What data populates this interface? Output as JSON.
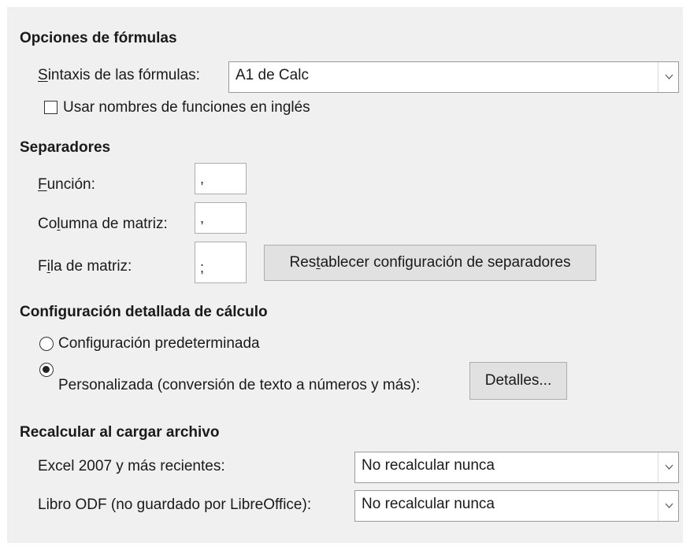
{
  "formula_options": {
    "heading": "Opciones de fórmulas",
    "syntax": {
      "label_prefix": "",
      "label_mnemonic": "S",
      "label_rest": "intaxis de las fórmulas:",
      "value": "A1 de Calc"
    },
    "english_names": {
      "label": "Usar nombres de funciones en inglés",
      "checked": false
    }
  },
  "separators": {
    "heading": "Separadores",
    "function": {
      "label_prefix": "",
      "label_mnemonic": "F",
      "label_rest": "unción:",
      "value": ","
    },
    "array_column": {
      "label_prefix": "Co",
      "label_mnemonic": "l",
      "label_rest": "umna de matriz:",
      "value": ","
    },
    "array_row": {
      "label_prefix": "F",
      "label_mnemonic": "i",
      "label_rest": "la de matriz:",
      "value": ";"
    },
    "reset_button": {
      "label_prefix": "Res",
      "label_mnemonic": "t",
      "label_rest": "ablecer configuración de separadores"
    }
  },
  "detailed_calc": {
    "heading": "Configuración detallada de cálculo",
    "default_option": {
      "label": "Configuración predeterminada",
      "selected": false
    },
    "custom_option": {
      "label": "Personalizada (conversión de texto a números y más):",
      "selected": true
    },
    "details_button": "Detalles..."
  },
  "recalc_on_load": {
    "heading": "Recalcular al cargar archivo",
    "excel": {
      "label": "Excel 2007 y más recientes:",
      "value": "No recalcular nunca"
    },
    "odf": {
      "label": "Libro ODF (no guardado por LibreOffice):",
      "value": "No recalcular nunca"
    }
  }
}
